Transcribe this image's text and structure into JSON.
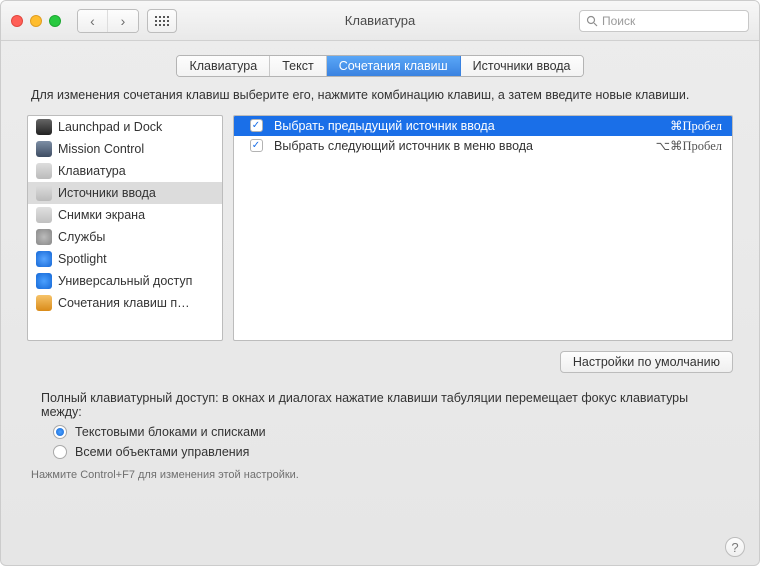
{
  "window": {
    "title": "Клавиатура"
  },
  "search": {
    "placeholder": "Поиск"
  },
  "tabs": [
    "Клавиатура",
    "Текст",
    "Сочетания клавиш",
    "Источники ввода"
  ],
  "active_tab_index": 2,
  "description": "Для изменения сочетания клавиш выберите его, нажмите комбинацию клавиш, а затем введите новые клавиши.",
  "categories": [
    {
      "label": "Launchpad и Dock",
      "icon": "launchpad"
    },
    {
      "label": "Mission Control",
      "icon": "mission"
    },
    {
      "label": "Клавиатура",
      "icon": "keyboard"
    },
    {
      "label": "Источники ввода",
      "icon": "input",
      "selected": true
    },
    {
      "label": "Снимки экрана",
      "icon": "screenshot"
    },
    {
      "label": "Службы",
      "icon": "services"
    },
    {
      "label": "Spotlight",
      "icon": "spotlight"
    },
    {
      "label": "Универсальный доступ",
      "icon": "accessibility"
    },
    {
      "label": "Сочетания клавиш п…",
      "icon": "appshortcuts"
    }
  ],
  "shortcuts": [
    {
      "checked": true,
      "selected": true,
      "label": "Выбрать предыдущий источник ввода",
      "keys": "⌘Пробел"
    },
    {
      "checked": true,
      "selected": false,
      "label": "Выбрать следующий источник в меню ввода",
      "keys": "⌥⌘Пробел"
    }
  ],
  "defaults_button": "Настройки по умолчанию",
  "fka": {
    "intro": "Полный клавиатурный доступ: в окнах и диалогах нажатие клавиши табуляции перемещает фокус клавиатуры между:",
    "opt1": "Текстовыми блоками и списками",
    "opt2": "Всеми объектами управления",
    "selected": 0,
    "hint": "Нажмите Control+F7 для изменения этой настройки."
  },
  "help": "?"
}
